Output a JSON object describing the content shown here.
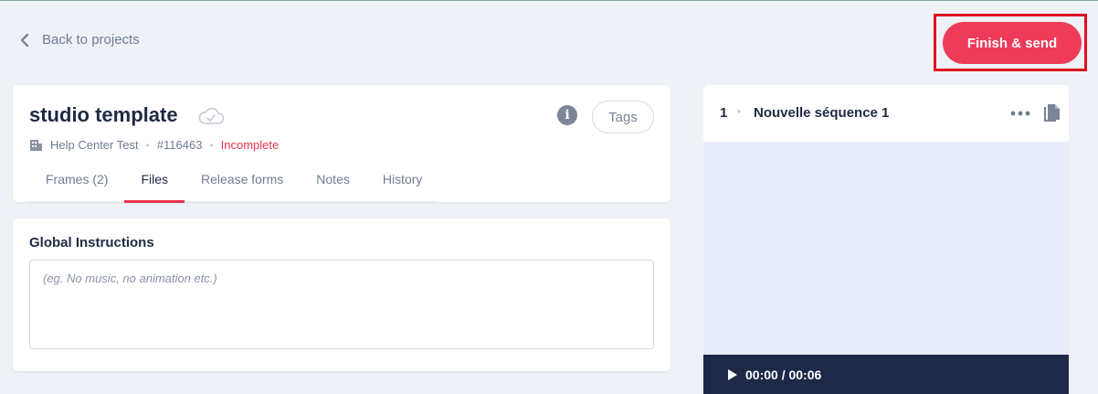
{
  "nav": {
    "back_label": "Back to projects"
  },
  "actions": {
    "finish_label": "Finish & send"
  },
  "project": {
    "title": "studio template",
    "tags_label": "Tags",
    "info_glyph": "i",
    "client": "Help Center Test",
    "id": "#116463",
    "status": "Incomplete",
    "status_color": "#e8334f",
    "tabs": [
      {
        "label": "Frames (2)",
        "active": false
      },
      {
        "label": "Files",
        "active": true
      },
      {
        "label": "Release forms",
        "active": false
      },
      {
        "label": "Notes",
        "active": false
      },
      {
        "label": "History",
        "active": false
      }
    ]
  },
  "instructions": {
    "title": "Global Instructions",
    "placeholder": "(eg. No music, no animation etc.)",
    "value": ""
  },
  "sequence": {
    "number": "1",
    "name": "Nouvelle séquence 1",
    "time": "00:00 / 00:06"
  },
  "colors": {
    "accent": "#ef3b5a",
    "highlight_frame": "#e0111f",
    "player_bg": "#1e2847",
    "preview_bg": "#e9ecfa"
  },
  "icons": {
    "back": "chevron-left-icon",
    "cloud": "cloud-check-icon",
    "info": "info-icon",
    "building": "building-icon",
    "more": "more-horizontal-icon",
    "copy": "copy-icon",
    "play": "play-icon"
  }
}
